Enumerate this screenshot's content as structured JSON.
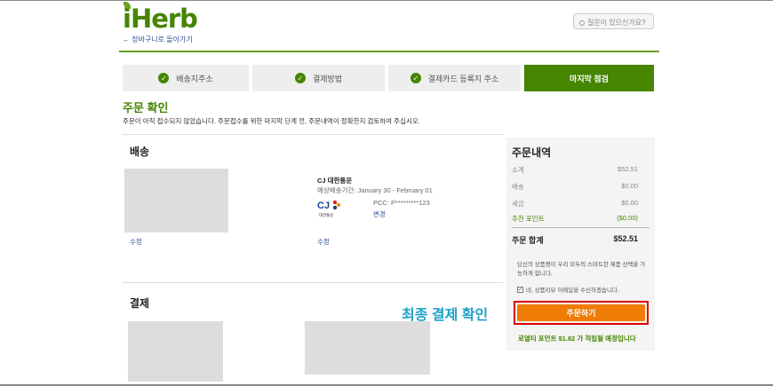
{
  "header": {
    "logo": "iHerb",
    "back_link": "← 장바구니로 돌아가기",
    "help_placeholder": "질문이 있으신가요?"
  },
  "steps": [
    {
      "label": "배송지주소",
      "done": true
    },
    {
      "label": "결제방법",
      "done": true
    },
    {
      "label": "결제카드 등록지 주소",
      "done": true
    },
    {
      "label": "마지막 점검",
      "done": false,
      "active": true
    }
  ],
  "check_glyph": "✓",
  "page": {
    "title": "주문 확인",
    "notice": "주문이 아직 접수되지 않았습니다. 주문접수를 위한 마지막 단계 전, 주문내역이 정확한지 검토하여 주십시오."
  },
  "shipping": {
    "heading": "배송",
    "address_edit": "수정",
    "carrier": "CJ 대한통운",
    "delivery_estimate": "예상배송기간: January 30 - February 01",
    "carrier_logo_text": "CJ",
    "carrier_logo_sub": "대한통운",
    "pcc": "PCC: P*********123",
    "pcc_edit": "변경",
    "carrier_edit": "수정"
  },
  "payment": {
    "heading": "결제"
  },
  "summary": {
    "title": "주문내역",
    "rows": [
      {
        "label": "소계",
        "value": "$52.51"
      },
      {
        "label": "배송",
        "value": "$0.00"
      },
      {
        "label": "세금",
        "value": "$0.00"
      },
      {
        "label": "추천 포인트",
        "value": "($0.00)"
      }
    ],
    "total_label": "주문 합계",
    "total_value": "$52.51",
    "legal": "당신의 상품평이 우리 모두의 스마트한 제품 선택을 가능하게 합니다.",
    "consent_label": "네, 상품리뷰 이메일을 수신하겠습니다.",
    "consent_checked": "✓",
    "order_button": "주문하기",
    "loyalty": "로열티 포인트 $1.82 가 적립될 예정입니다"
  },
  "annotation": "최종 결제 확인",
  "colors": {
    "brand_green": "#458500",
    "order_orange": "#ef7c05",
    "highlight_red": "#e00000",
    "annotation_blue": "#1ea2c8"
  }
}
